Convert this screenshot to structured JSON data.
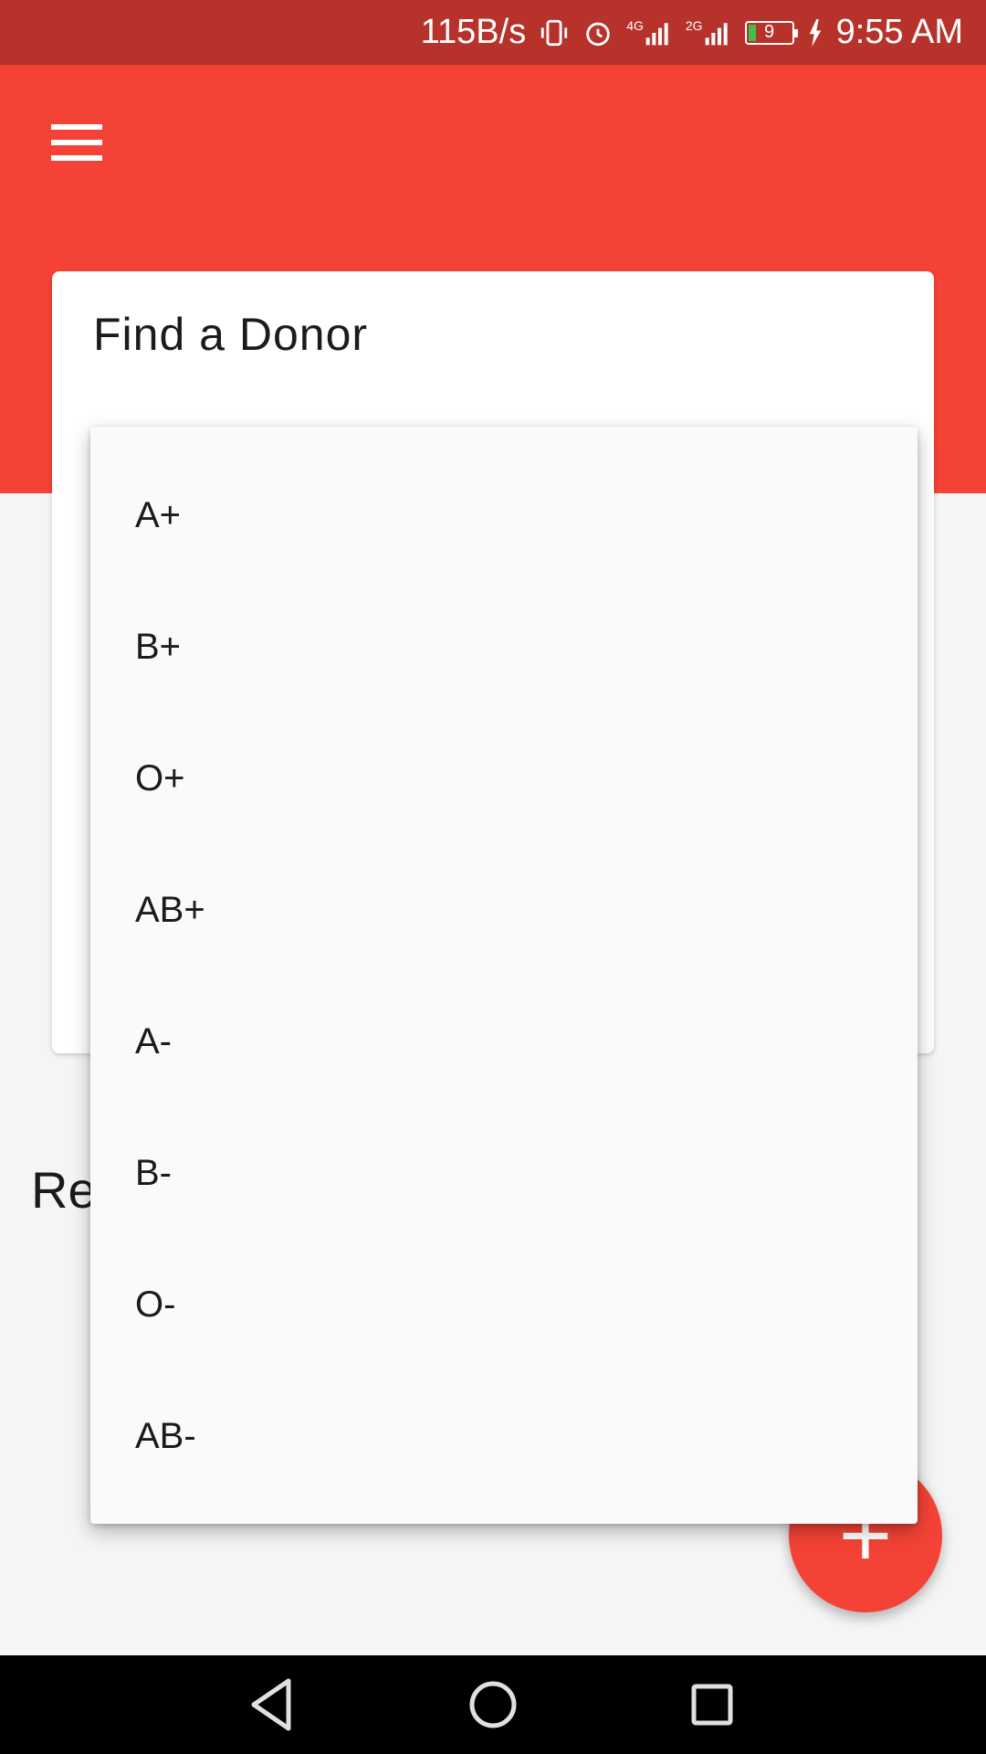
{
  "status_bar": {
    "net_speed": "115B/s",
    "signal_4g": "4G",
    "signal_2g": "2G",
    "battery_level": "9",
    "time": "9:55 AM"
  },
  "header": {
    "menu_icon": "menu-icon"
  },
  "card": {
    "title": "Find a Donor"
  },
  "recent": {
    "label_visible": "Re"
  },
  "dropdown": {
    "options": [
      "A+",
      "B+",
      "O+",
      "AB+",
      "A-",
      "B-",
      "O-",
      "AB-"
    ]
  },
  "fab": {
    "label": "+"
  },
  "colors": {
    "primary": "#f44336",
    "primary_dark": "#b7322b"
  }
}
